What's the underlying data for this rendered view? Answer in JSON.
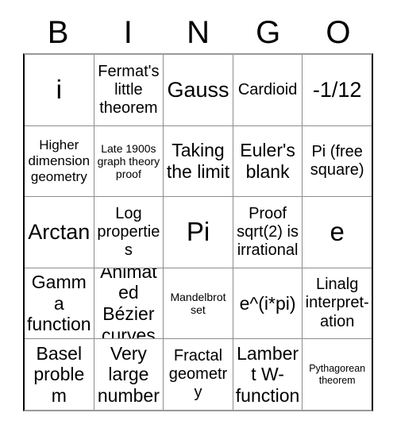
{
  "card": {
    "title": "BINGO",
    "header_letters": [
      "B",
      "I",
      "N",
      "G",
      "O"
    ],
    "colors": {
      "background": "#ffffff",
      "text": "#000000",
      "inner_gridline": "#8d8d8d",
      "outer_border_vertical": "#000000",
      "outer_border_horizontal": "#9a9a9a"
    },
    "grid_size": "5x5",
    "free_square": "Pi (free square)",
    "rows": [
      [
        {
          "text": "i",
          "size": "xxl"
        },
        {
          "text": "Fermat's little theorem",
          "size": "md"
        },
        {
          "text": "Gauss",
          "size": "xl"
        },
        {
          "text": "Cardioid",
          "size": "md"
        },
        {
          "text": "-1/12",
          "size": "xl"
        }
      ],
      [
        {
          "text": "Higher dimension geometry",
          "size": "sm"
        },
        {
          "text": "Late 1900s graph theory proof",
          "size": "xs"
        },
        {
          "text": "Taking the limit",
          "size": "lg"
        },
        {
          "text": "Euler's blank",
          "size": "lg"
        },
        {
          "text": "Pi (free square)",
          "size": "md"
        }
      ],
      [
        {
          "text": "Arctan",
          "size": "xl"
        },
        {
          "text": "Log properties",
          "size": "md"
        },
        {
          "text": "Pi",
          "size": "xxl"
        },
        {
          "text": "Proof sqrt(2) is irrational",
          "size": "md"
        },
        {
          "text": "e",
          "size": "xxl"
        }
      ],
      [
        {
          "text": "Gamma function",
          "size": "lg"
        },
        {
          "text": "Animated Bézier curves",
          "size": "lg"
        },
        {
          "text": "Mandelbrot set",
          "size": "xs"
        },
        {
          "text": "e^(i*pi)",
          "size": "lg"
        },
        {
          "text": "Linalg interpret-ation",
          "size": "md"
        }
      ],
      [
        {
          "text": "Basel problem",
          "size": "lg"
        },
        {
          "text": "Very large number",
          "size": "lg"
        },
        {
          "text": "Fractal geometry",
          "size": "md"
        },
        {
          "text": "Lambert W-function",
          "size": "lg"
        },
        {
          "text": "Pythagorean theorem",
          "size": "xxs"
        }
      ]
    ]
  }
}
